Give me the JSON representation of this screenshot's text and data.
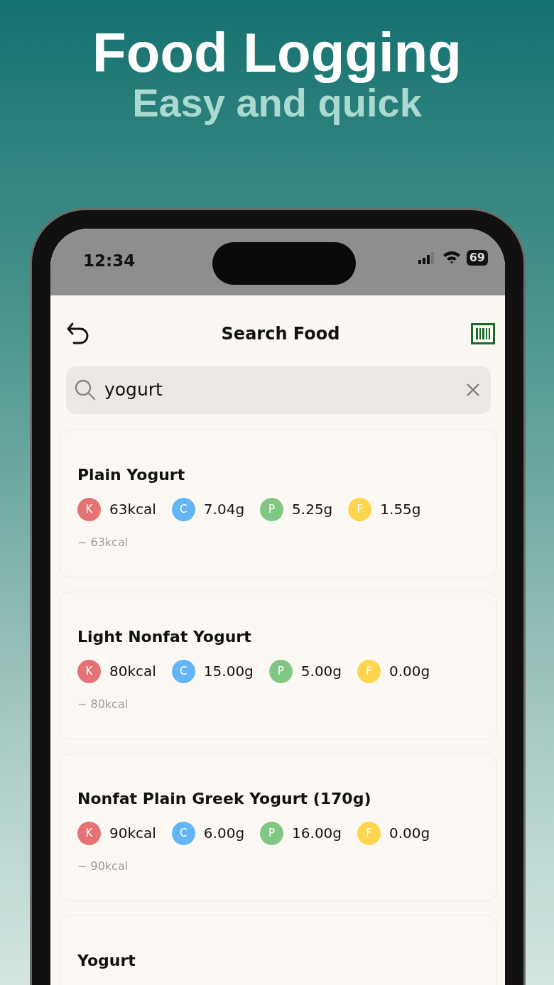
{
  "header": {
    "title": "Food Logging",
    "subtitle": "Easy and quick"
  },
  "status_bar": {
    "time": "12:34",
    "battery": "69"
  },
  "app_bar": {
    "title": "Search Food"
  },
  "search": {
    "value": "yogurt"
  },
  "results": [
    {
      "name": "Plain Yogurt",
      "nutrients": [
        {
          "letter": "K",
          "color": "#e57373",
          "value": "63kcal"
        },
        {
          "letter": "C",
          "color": "#64b5f6",
          "value": "7.04g"
        },
        {
          "letter": "P",
          "color": "#81c784",
          "value": "5.25g"
        },
        {
          "letter": "F",
          "color": "#ffd54f",
          "value": "1.55g"
        }
      ],
      "summary": "~ 63kcal"
    },
    {
      "name": "Light Nonfat Yogurt",
      "nutrients": [
        {
          "letter": "K",
          "color": "#e57373",
          "value": "80kcal"
        },
        {
          "letter": "C",
          "color": "#64b5f6",
          "value": "15.00g"
        },
        {
          "letter": "P",
          "color": "#81c784",
          "value": "5.00g"
        },
        {
          "letter": "F",
          "color": "#ffd54f",
          "value": "0.00g"
        }
      ],
      "summary": "~ 80kcal"
    },
    {
      "name": "Nonfat Plain Greek Yogurt (170g)",
      "nutrients": [
        {
          "letter": "K",
          "color": "#e57373",
          "value": "90kcal"
        },
        {
          "letter": "C",
          "color": "#64b5f6",
          "value": "6.00g"
        },
        {
          "letter": "P",
          "color": "#81c784",
          "value": "16.00g"
        },
        {
          "letter": "F",
          "color": "#ffd54f",
          "value": "0.00g"
        }
      ],
      "summary": "~ 90kcal"
    },
    {
      "name": "Yogurt"
    }
  ]
}
